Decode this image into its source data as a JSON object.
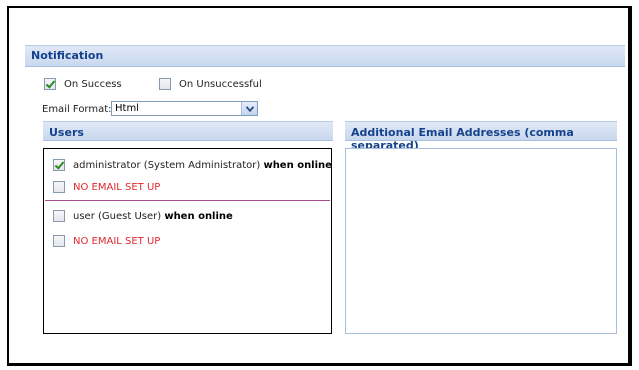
{
  "notification": {
    "title": "Notification",
    "on_success_label": "On Success",
    "on_success_checked": true,
    "on_unsuccessful_label": "On Unsuccessful",
    "on_unsuccessful_checked": false,
    "email_format_label": "Email Format:",
    "email_format_value": "Html"
  },
  "users": {
    "header": "Users",
    "items": [
      {
        "name": "administrator (System Administrator)",
        "status": "when online",
        "checked": true
      },
      {
        "warning": "NO EMAIL SET UP",
        "checked": false
      },
      {
        "name": "user (Guest User)",
        "status": "when online",
        "checked": false
      },
      {
        "warning": "NO EMAIL SET UP",
        "checked": false
      }
    ]
  },
  "additional_emails": {
    "header": "Additional Email Addresses (comma separated)",
    "value": ""
  },
  "colors": {
    "header_text": "#15428b",
    "warning_text": "#e0282e",
    "divider": "#a64d8e",
    "check": "#2e8b22"
  }
}
